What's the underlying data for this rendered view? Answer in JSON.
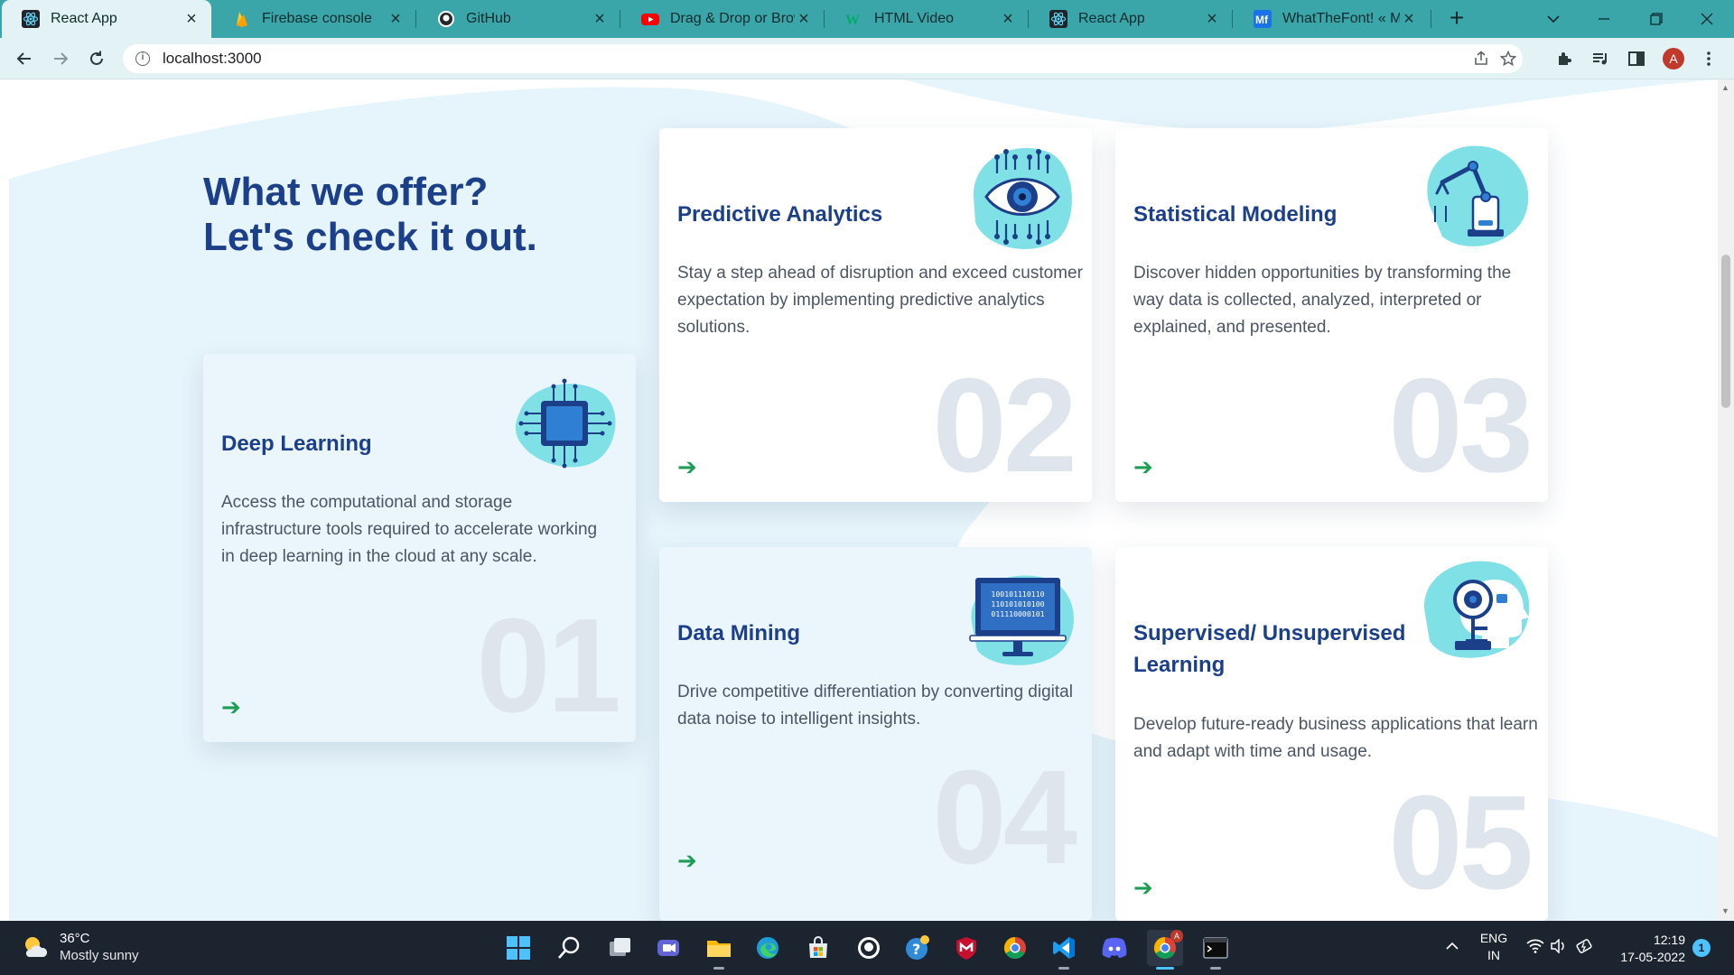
{
  "browser": {
    "tabs": [
      {
        "title": "React App",
        "icon": "react-icon",
        "active": true
      },
      {
        "title": "Firebase console",
        "icon": "firebase-icon",
        "active": false
      },
      {
        "title": "GitHub",
        "icon": "github-icon",
        "active": false
      },
      {
        "title": "Drag & Drop or Brow",
        "icon": "youtube-icon",
        "active": false
      },
      {
        "title": "HTML Video",
        "icon": "w3schools-icon",
        "active": false
      },
      {
        "title": "React App",
        "icon": "react-icon",
        "active": false
      },
      {
        "title": "WhatTheFont! « MyFo",
        "icon": "myfonts-icon",
        "active": false
      }
    ],
    "url": "localhost:3000",
    "profile_initial": "A"
  },
  "page": {
    "headline_line1": "What we offer?",
    "headline_line2": "Let's check it out.",
    "cards": [
      {
        "number": "01",
        "title": "Deep Learning",
        "description": "Access the computational and storage infrastructure tools required to accelerate working in deep learning in the cloud at any scale.",
        "icon": "chip-icon"
      },
      {
        "number": "02",
        "title": "Predictive Analytics",
        "description": "Stay a step ahead of disruption and exceed customer expectation by implementing predictive analytics solutions.",
        "icon": "eye-circuit-icon"
      },
      {
        "number": "03",
        "title": "Statistical Modeling",
        "description": "Discover hidden opportunities by transforming the way data is collected, analyzed, interpreted or explained, and presented.",
        "icon": "robot-arm-icon"
      },
      {
        "number": "04",
        "title": "Data Mining",
        "description": "Drive competitive differentiation by converting digital data noise to intelligent insights.",
        "icon": "binary-monitor-icon",
        "binary": [
          "100101110110",
          "110101010100",
          "011110000101"
        ]
      },
      {
        "number": "05",
        "title": "Supervised/ Unsupervised Learning",
        "description": "Develop future-ready business applications that learn and adapt with time and usage.",
        "icon": "ai-head-icon"
      }
    ],
    "arrow_glyph": "➔"
  },
  "taskbar": {
    "temperature": "36°C",
    "weather": "Mostly sunny",
    "language_line1": "ENG",
    "language_line2": "IN",
    "time": "12:19",
    "date": "17-05-2022",
    "notification_count": "1",
    "chrome_badge": "A"
  },
  "colors": {
    "accent": "#1c3f8a",
    "tab_strip": "#3aa6a9",
    "card_number": "#dfe5ec",
    "arrow": "#1f9d55",
    "illustration": "#7fe0e6"
  }
}
